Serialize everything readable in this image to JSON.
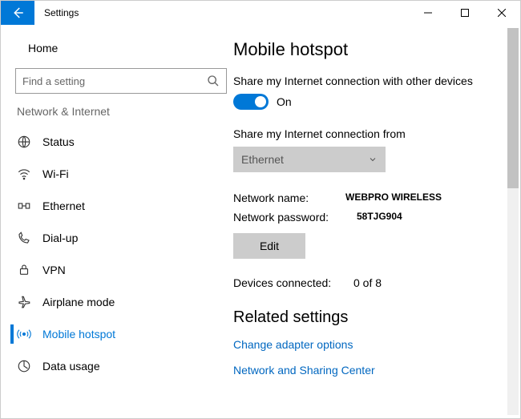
{
  "window": {
    "title": "Settings"
  },
  "sidebar": {
    "home": "Home",
    "search_placeholder": "Find a setting",
    "category": "Network & Internet",
    "items": [
      {
        "label": "Status"
      },
      {
        "label": "Wi-Fi"
      },
      {
        "label": "Ethernet"
      },
      {
        "label": "Dial-up"
      },
      {
        "label": "VPN"
      },
      {
        "label": "Airplane mode"
      },
      {
        "label": "Mobile hotspot"
      },
      {
        "label": "Data usage"
      }
    ]
  },
  "main": {
    "heading": "Mobile hotspot",
    "share_label": "Share my Internet connection with other devices",
    "toggle_state": "On",
    "share_from_label": "Share my Internet connection from",
    "share_from_value": "Ethernet",
    "network_name_label": "Network name:",
    "network_name_value": "WEBPRO WIRELESS",
    "network_password_label": "Network password:",
    "network_password_value": "58TJG904",
    "edit_label": "Edit",
    "devices_label": "Devices connected:",
    "devices_value": "0 of 8",
    "related_heading": "Related settings",
    "link1": "Change adapter options",
    "link2": "Network and Sharing Center"
  }
}
